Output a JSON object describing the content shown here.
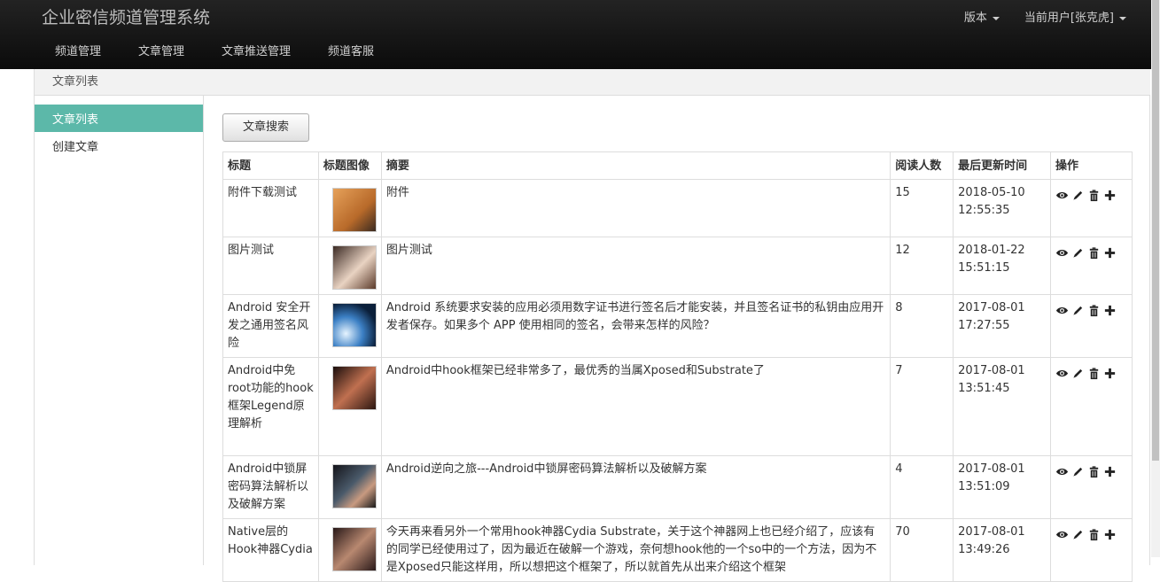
{
  "header": {
    "title": "企业密信频道管理系统",
    "nav": [
      "频道管理",
      "文章管理",
      "文章推送管理",
      "频道客服"
    ],
    "version_label": "版本",
    "user_label": "当前用户[张克虎]"
  },
  "breadcrumb": "文章列表",
  "sidebar": {
    "items": [
      {
        "label": "文章列表",
        "active": true
      },
      {
        "label": "创建文章",
        "active": false
      }
    ]
  },
  "search_button": "文章搜索",
  "table": {
    "headers": [
      "标题",
      "标题图像",
      "摘要",
      "阅读人数",
      "最后更新时间",
      "操作"
    ],
    "rows": [
      {
        "title": "附件下载测试",
        "summary": "附件",
        "reads": "15",
        "time": "2018-05-10 12:55:35"
      },
      {
        "title": "图片测试",
        "summary": "图片测试",
        "reads": "12",
        "time": "2018-01-22 15:51:15"
      },
      {
        "title": "Android 安全开发之通用签名风险",
        "summary": "Android 系统要求安装的应用必须用数字证书进行签名后才能安装，并且签名证书的私钥由应用开发者保存。如果多个 APP 使用相同的签名，会带来怎样的风险？",
        "reads": "8",
        "time": "2017-08-01 17:27:55"
      },
      {
        "title": "Android中免root功能的hook框架Legend原理解析",
        "summary": "Android中hook框架已经非常多了，最优秀的当属Xposed和Substrate了",
        "reads": "7",
        "time": "2017-08-01 13:51:45"
      },
      {
        "title": "Android中锁屏密码算法解析以及破解方案",
        "summary": "Android逆向之旅---Android中锁屏密码算法解析以及破解方案",
        "reads": "4",
        "time": "2017-08-01 13:51:09"
      },
      {
        "title": "Native层的Hook神器Cydia",
        "summary": "今天再来看另外一个常用hook神器Cydia Substrate，关于这个神器网上也已经介绍了，应该有的同学已经使用过了，因为最近在破解一个游戏，奈何想hook他的一个so中的一个方法，因为不是Xposed只能这样用，所以想把这个框架了，所以就首先从出来介绍这个框架",
        "reads": "70",
        "time": "2017-08-01 13:49:26"
      }
    ]
  }
}
